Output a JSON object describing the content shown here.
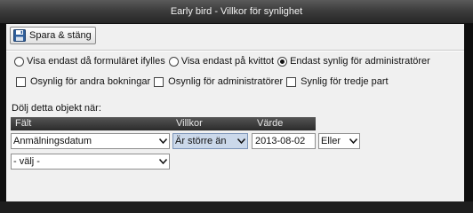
{
  "window": {
    "title": "Early bird - Villkor för synlighet"
  },
  "toolbar": {
    "save_label": "Spara & stäng"
  },
  "visibility_radios": [
    {
      "label": "Visa endast då formuläret ifylles",
      "checked": false
    },
    {
      "label": "Visa endast på kvittot",
      "checked": false
    },
    {
      "label": "Endast synlig för administratörer",
      "checked": true
    }
  ],
  "visibility_checks": [
    {
      "label": "Osynlig för andra bokningar",
      "checked": false
    },
    {
      "label": "Osynlig för administratörer",
      "checked": false
    },
    {
      "label": "Synlig för tredje part",
      "checked": false
    }
  ],
  "hide_section": {
    "label": "Dölj detta objekt när:"
  },
  "table": {
    "headers": {
      "field": "Fält",
      "condition": "Villkor",
      "value": "Värde"
    },
    "row1": {
      "field": "Anmälningsdatum",
      "condition": "Är större än",
      "value": "2013-08-02",
      "connector": "Eller"
    },
    "row2": {
      "field": "- välj -"
    }
  }
}
